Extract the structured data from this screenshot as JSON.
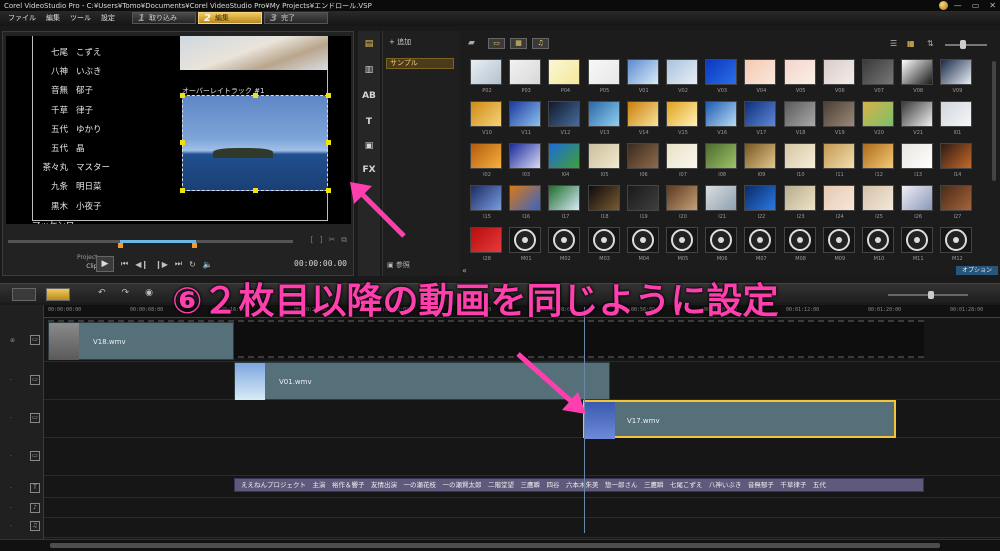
{
  "window": {
    "title": "Corel VideoStudio Pro - C:¥Users¥Tomo¥Documents¥Corel VideoStudio Pro¥My Projects¥エンドロール.VSP"
  },
  "menu": {
    "file": "ファイル",
    "edit": "編集",
    "tools": "ツール",
    "settings": "設定"
  },
  "steps": [
    {
      "num": "1",
      "label": "取り込み"
    },
    {
      "num": "2",
      "label": "編集"
    },
    {
      "num": "3",
      "label": "完了"
    }
  ],
  "preview": {
    "credits": [
      {
        "a": "七尾",
        "b": "こずえ"
      },
      {
        "a": "八神",
        "b": "いぶき"
      },
      {
        "a": "音無",
        "b": "郁子"
      },
      {
        "a": "千草",
        "b": "律子"
      },
      {
        "a": "五代",
        "b": "ゆかり"
      },
      {
        "a": "五代",
        "b": "晶"
      },
      {
        "a": "茶々丸",
        "b": "マスター"
      },
      {
        "a": "九条",
        "b": "明日菜"
      },
      {
        "a": "黒木",
        "b": "小夜子"
      },
      {
        "a": "マッケンロー",
        "b": ""
      }
    ],
    "overlay_label": "オーバーレイトラック #1",
    "project_label": "Project",
    "clip_label": "Clip",
    "timecode": "00:00:00.00"
  },
  "library": {
    "add_label": "追加",
    "folder": "サンプル",
    "browse_label": "参照",
    "option_label": "オプション",
    "thumbs": [
      {
        "cap": "P02",
        "c1": "#e8eef3",
        "c2": "#b4c2cf"
      },
      {
        "cap": "P03",
        "c1": "#f2f2f2",
        "c2": "#d8d8d8"
      },
      {
        "cap": "P04",
        "c1": "#fbf7d6",
        "c2": "#f3e89a"
      },
      {
        "cap": "P05",
        "c1": "#f7f7f7",
        "c2": "#e8e8e8"
      },
      {
        "cap": "V01",
        "c1": "#5d8bd0",
        "c2": "#d9ecf7"
      },
      {
        "cap": "V02",
        "c1": "#a8c3de",
        "c2": "#e8eef5"
      },
      {
        "cap": "V03",
        "c1": "#0b37c0",
        "c2": "#2a6fe8"
      },
      {
        "cap": "V04",
        "c1": "#f6c8b0",
        "c2": "#f9e8dd"
      },
      {
        "cap": "V05",
        "c1": "#f3d6c8",
        "c2": "#fbefe8"
      },
      {
        "cap": "V06",
        "c1": "#d9ccc9",
        "c2": "#f3ece8"
      },
      {
        "cap": "V07",
        "c1": "#3a3a3a",
        "c2": "#777777"
      },
      {
        "cap": "V08",
        "c1": "#ffffff",
        "c2": "#1a1a1a"
      },
      {
        "cap": "V09",
        "c1": "#1b2a48",
        "c2": "#e8eef5"
      },
      {
        "cap": "V10",
        "c1": "#d08b15",
        "c2": "#f6d27a"
      },
      {
        "cap": "V11",
        "c1": "#1e3a9e",
        "c2": "#8cc2f0"
      },
      {
        "cap": "V12",
        "c1": "#0e1a2c",
        "c2": "#4a6c9e"
      },
      {
        "cap": "V13",
        "c1": "#2c68a8",
        "c2": "#8fd0ef"
      },
      {
        "cap": "V14",
        "c1": "#c87f0d",
        "c2": "#fbe39a"
      },
      {
        "cap": "V15",
        "c1": "#e0a21b",
        "c2": "#fff2b8"
      },
      {
        "cap": "V16",
        "c1": "#1d5ab0",
        "c2": "#b8dcf6"
      },
      {
        "cap": "V17",
        "c1": "#0d2f7a",
        "c2": "#5f88d8"
      },
      {
        "cap": "V18",
        "c1": "#5a5a5a",
        "c2": "#aaaaaa"
      },
      {
        "cap": "V19",
        "c1": "#4a3f35",
        "c2": "#9c8a78"
      },
      {
        "cap": "V20",
        "c1": "#d6b24a",
        "c2": "#7cc06a"
      },
      {
        "cap": "V21",
        "c1": "#3a3a3a",
        "c2": "#f0f0f0"
      },
      {
        "cap": "I01",
        "c1": "#cfd6dd",
        "c2": "#f7f7f7"
      },
      {
        "cap": "I02",
        "c1": "#b35a0d",
        "c2": "#f6b23e"
      },
      {
        "cap": "I03",
        "c1": "#1c2b9a",
        "c2": "#d7dbf6"
      },
      {
        "cap": "I04",
        "c1": "#1d6bd6",
        "c2": "#3fa03a"
      },
      {
        "cap": "I05",
        "c1": "#cbbf9b",
        "c2": "#f1ead3"
      },
      {
        "cap": "I06",
        "c1": "#3a2b20",
        "c2": "#8f6b4a"
      },
      {
        "cap": "I07",
        "c1": "#e8e2c8",
        "c2": "#fbf8ee"
      },
      {
        "cap": "I08",
        "c1": "#4f6a2e",
        "c2": "#9bc46a"
      },
      {
        "cap": "I09",
        "c1": "#7a5520",
        "c2": "#e3c88e"
      },
      {
        "cap": "I10",
        "c1": "#d5c6a3",
        "c2": "#f7efdb"
      },
      {
        "cap": "I11",
        "c1": "#c39a51",
        "c2": "#f2deb0"
      },
      {
        "cap": "I12",
        "c1": "#ad6c1a",
        "c2": "#f5c978"
      },
      {
        "cap": "I13",
        "c1": "#e9e6e0",
        "c2": "#ffffff"
      },
      {
        "cap": "I14",
        "c1": "#2e1b12",
        "c2": "#c46a2a"
      },
      {
        "cap": "I15",
        "c1": "#1b2a63",
        "c2": "#7a9ee0"
      },
      {
        "cap": "I16",
        "c1": "#d87a12",
        "c2": "#3a63c8"
      },
      {
        "cap": "I17",
        "c1": "#1f6c2c",
        "c2": "#d7e9f7"
      },
      {
        "cap": "I18",
        "c1": "#0c0c0c",
        "c2": "#7a5a30"
      },
      {
        "cap": "I19",
        "c1": "#1a1a1a",
        "c2": "#3f3f3f"
      },
      {
        "cap": "I20",
        "c1": "#5a3a22",
        "c2": "#c9a077"
      },
      {
        "cap": "I21",
        "c1": "#d9dde1",
        "c2": "#8ea0b0"
      },
      {
        "cap": "I22",
        "c1": "#0a2a6a",
        "c2": "#2a7ae0"
      },
      {
        "cap": "I23",
        "c1": "#b8ab8e",
        "c2": "#efe4c7"
      },
      {
        "cap": "I24",
        "c1": "#e6c9b3",
        "c2": "#f7e6d8"
      },
      {
        "cap": "I25",
        "c1": "#d3c0a8",
        "c2": "#f4e9db"
      },
      {
        "cap": "I26",
        "c1": "#f0f0f5",
        "c2": "#8a96b8"
      },
      {
        "cap": "I27",
        "c1": "#4a2a18",
        "c2": "#a6643a"
      },
      {
        "cap": "I28",
        "c1": "#b80d0d",
        "c2": "#e83a3a"
      },
      {
        "cap": "M01",
        "c1": "#dddddd",
        "c2": "#222222"
      },
      {
        "cap": "M02",
        "c1": "#dddddd",
        "c2": "#222222"
      },
      {
        "cap": "M03",
        "c1": "#dddddd",
        "c2": "#222222"
      },
      {
        "cap": "M04",
        "c1": "#dddddd",
        "c2": "#222222"
      },
      {
        "cap": "M05",
        "c1": "#dddddd",
        "c2": "#222222"
      },
      {
        "cap": "M06",
        "c1": "#dddddd",
        "c2": "#222222"
      },
      {
        "cap": "M07",
        "c1": "#dddddd",
        "c2": "#222222"
      },
      {
        "cap": "M08",
        "c1": "#dddddd",
        "c2": "#222222"
      },
      {
        "cap": "M09",
        "c1": "#dddddd",
        "c2": "#222222"
      },
      {
        "cap": "M10",
        "c1": "#dddddd",
        "c2": "#222222"
      },
      {
        "cap": "M11",
        "c1": "#dddddd",
        "c2": "#222222"
      },
      {
        "cap": "M12",
        "c1": "#dddddd",
        "c2": "#222222"
      }
    ]
  },
  "timeline": {
    "ruler": [
      "00:00:00:00",
      "00:00:08:00",
      "00:00:16:00",
      "00:00:24:00",
      "00:00:32:00",
      "00:00:40:00",
      "00:00:48:00",
      "00:00:56:00",
      "00:01:04:00",
      "00:01:12:00",
      "00:01:20:00",
      "00:01:28:00"
    ],
    "clips": {
      "v18": "V18.wmv",
      "v01": "V01.wmv",
      "v17": "V17.wmv"
    },
    "title_clip": "ええねんプロジェクト　主演　裕作＆響子　友情出演　一の瀬花枝　一の瀬賢太郎　二階堂望　三鷹瞬　四谷　六本木朱美　惣一郎さん　三鷹瞬　七尾こずえ　八神いぶき　音無郁子　千草律子　五代"
  },
  "annotation": "⑥２枚目以降の動画を同じように設定",
  "colors": {
    "accent": "#f4c95b",
    "annotation": "#ff3fae",
    "clip": "#56707a",
    "selection": "#f2c437"
  }
}
